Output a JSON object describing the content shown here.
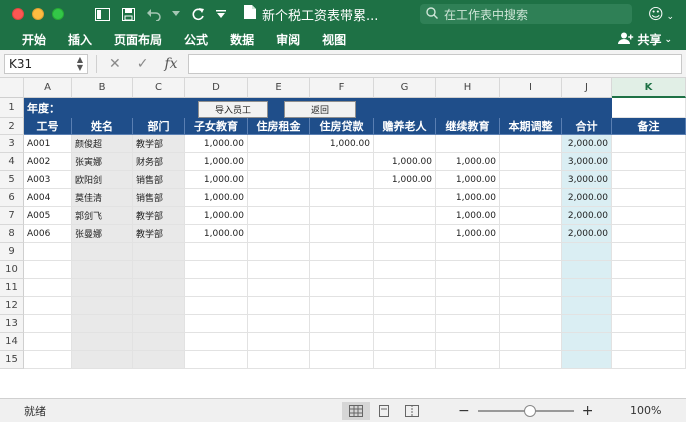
{
  "window": {
    "title": "新个税工资表带累...",
    "search_placeholder": "在工作表中搜索"
  },
  "ribbon": {
    "tabs": [
      "开始",
      "插入",
      "页面布局",
      "公式",
      "数据",
      "审阅",
      "视图"
    ],
    "share_label": "共享"
  },
  "formula_bar": {
    "name_box": "K31",
    "fx_label": "fx",
    "formula": ""
  },
  "sheet": {
    "columns": [
      "A",
      "B",
      "C",
      "D",
      "E",
      "F",
      "G",
      "H",
      "I",
      "J",
      "K"
    ],
    "selected_column": "K",
    "rows": [
      "1",
      "2",
      "3",
      "4",
      "5",
      "6",
      "7",
      "8",
      "9",
      "10",
      "11",
      "12",
      "13",
      "14",
      "15"
    ],
    "year_label": "年度：",
    "buttons": {
      "import": "导入员工",
      "back": "返回"
    },
    "headers": [
      "工号",
      "姓名",
      "部门",
      "子女教育",
      "住房租金",
      "住房贷款",
      "赡养老人",
      "继续教育",
      "本期调整",
      "合计",
      "备注"
    ],
    "data": [
      [
        "A001",
        "颜俊超",
        "教学部",
        "1,000.00",
        "",
        "1,000.00",
        "",
        "",
        "",
        "2,000.00",
        ""
      ],
      [
        "A002",
        "张寅娜",
        "财务部",
        "1,000.00",
        "",
        "",
        "1,000.00",
        "1,000.00",
        "",
        "3,000.00",
        ""
      ],
      [
        "A003",
        "欧阳剑",
        "销售部",
        "1,000.00",
        "",
        "",
        "1,000.00",
        "1,000.00",
        "",
        "3,000.00",
        ""
      ],
      [
        "A004",
        "莫佳清",
        "销售部",
        "1,000.00",
        "",
        "",
        "",
        "1,000.00",
        "",
        "2,000.00",
        ""
      ],
      [
        "A005",
        "郭剑飞",
        "教学部",
        "1,000.00",
        "",
        "",
        "",
        "1,000.00",
        "",
        "2,000.00",
        ""
      ],
      [
        "A006",
        "张曼娜",
        "教学部",
        "1,000.00",
        "",
        "",
        "",
        "1,000.00",
        "",
        "2,000.00",
        ""
      ]
    ]
  },
  "status_bar": {
    "status": "就绪",
    "zoom": "100%",
    "zoom_minus": "−",
    "zoom_plus": "+"
  },
  "colors": {
    "app_green": "#1e7145",
    "header_blue": "#1f4e8a",
    "total_column": "#daeef3",
    "name_column": "#e9e9e9"
  }
}
